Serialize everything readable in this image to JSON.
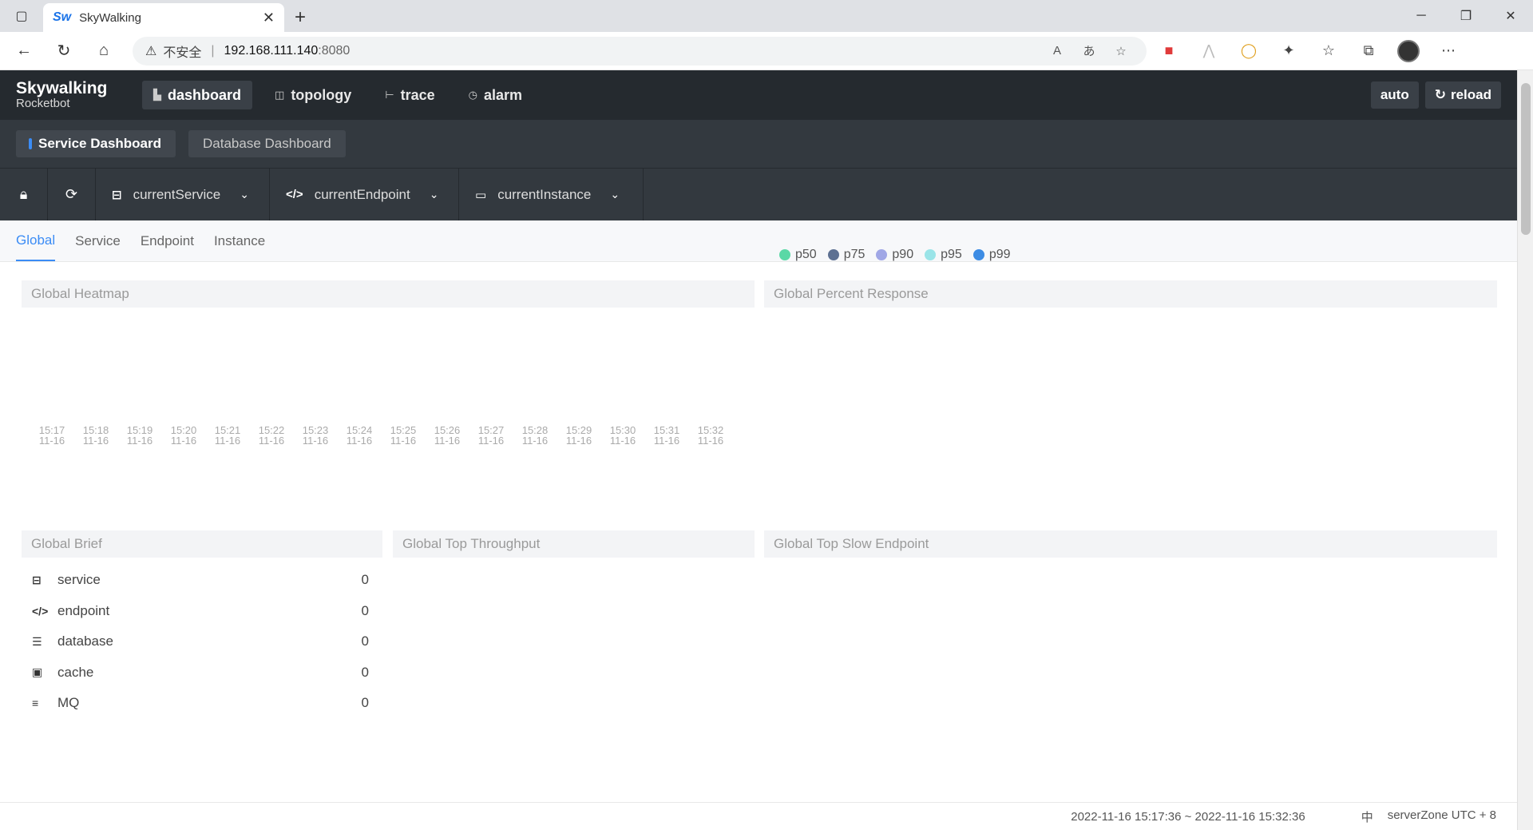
{
  "browser": {
    "tab_title": "SkyWalking",
    "tab_favicon": "Sw",
    "insecure_label": "不安全",
    "url_host": "192.168.111.140",
    "url_port": ":8080"
  },
  "app": {
    "logo_line1": "Skywalking",
    "logo_line2": "Rocketbot",
    "nav": [
      {
        "label": "dashboard",
        "icon": "dashboard-icon",
        "active": true
      },
      {
        "label": "topology",
        "icon": "topology-icon"
      },
      {
        "label": "trace",
        "icon": "trace-icon"
      },
      {
        "label": "alarm",
        "icon": "alarm-icon"
      }
    ],
    "auto_label": "auto",
    "reload_label": "reload"
  },
  "dashboards": [
    {
      "label": "Service Dashboard",
      "active": true
    },
    {
      "label": "Database Dashboard"
    }
  ],
  "toolbar": {
    "service": "currentService",
    "endpoint": "currentEndpoint",
    "instance": "currentInstance"
  },
  "subtabs": [
    {
      "label": "Global",
      "active": true
    },
    {
      "label": "Service"
    },
    {
      "label": "Endpoint"
    },
    {
      "label": "Instance"
    }
  ],
  "panels": {
    "heatmap_title": "Global Heatmap",
    "percent_title": "Global Percent Response",
    "brief_title": "Global Brief",
    "throughput_title": "Global Top Throughput",
    "slow_title": "Global Top Slow Endpoint"
  },
  "percent_legend": [
    {
      "label": "p50",
      "color": "#5ad8a6"
    },
    {
      "label": "p75",
      "color": "#5d7092"
    },
    {
      "label": "p90",
      "color": "#a0a7e6"
    },
    {
      "label": "p95",
      "color": "#9ae4e8"
    },
    {
      "label": "p99",
      "color": "#3d8ce4"
    }
  ],
  "heatmap_ticks": [
    {
      "time": "15:17",
      "date": "11-16"
    },
    {
      "time": "15:18",
      "date": "11-16"
    },
    {
      "time": "15:19",
      "date": "11-16"
    },
    {
      "time": "15:20",
      "date": "11-16"
    },
    {
      "time": "15:21",
      "date": "11-16"
    },
    {
      "time": "15:22",
      "date": "11-16"
    },
    {
      "time": "15:23",
      "date": "11-16"
    },
    {
      "time": "15:24",
      "date": "11-16"
    },
    {
      "time": "15:25",
      "date": "11-16"
    },
    {
      "time": "15:26",
      "date": "11-16"
    },
    {
      "time": "15:27",
      "date": "11-16"
    },
    {
      "time": "15:28",
      "date": "11-16"
    },
    {
      "time": "15:29",
      "date": "11-16"
    },
    {
      "time": "15:30",
      "date": "11-16"
    },
    {
      "time": "15:31",
      "date": "11-16"
    },
    {
      "time": "15:32",
      "date": "11-16"
    }
  ],
  "brief": [
    {
      "label": "service",
      "value": "0",
      "icon": "service-icon"
    },
    {
      "label": "endpoint",
      "value": "0",
      "icon": "endpoint-icon"
    },
    {
      "label": "database",
      "value": "0",
      "icon": "database-icon"
    },
    {
      "label": "cache",
      "value": "0",
      "icon": "cache-icon"
    },
    {
      "label": "MQ",
      "value": "0",
      "icon": "mq-icon"
    }
  ],
  "footer": {
    "time_range": "2022-11-16 15:17:36 ~ 2022-11-16 15:32:36",
    "lang": "中",
    "zone": "serverZone UTC + 8"
  }
}
